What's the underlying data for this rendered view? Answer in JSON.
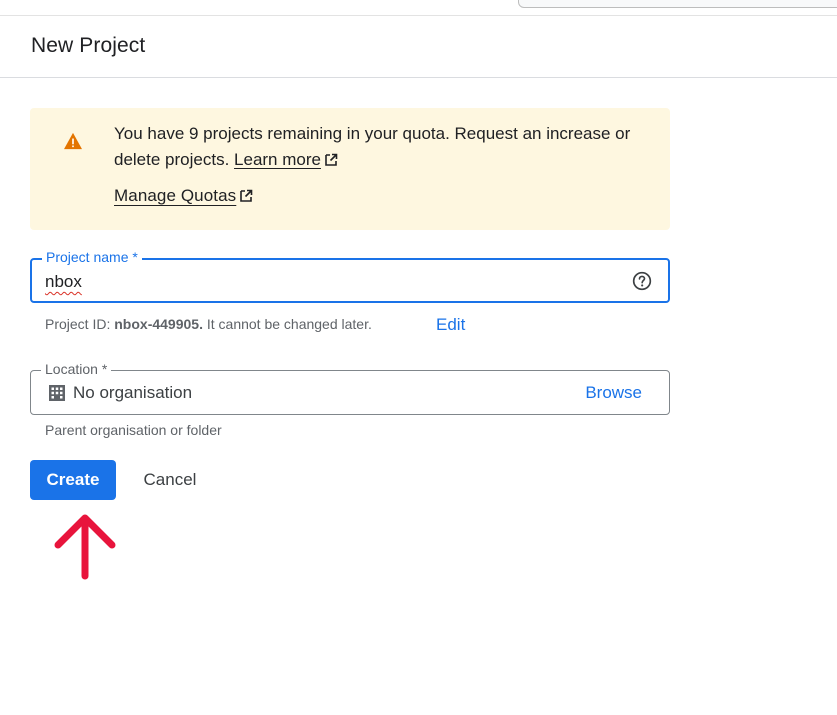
{
  "header": {
    "title": "New Project"
  },
  "quota_banner": {
    "icon": "warning-icon",
    "message": "You have 9 projects remaining in your quota. Request an increase or delete projects.",
    "learn_more_label": "Learn more",
    "manage_quotas_label": "Manage Quotas"
  },
  "project_name": {
    "label": "Project name *",
    "value": "nbox",
    "help_icon": "help-circle-icon"
  },
  "project_id": {
    "prefix": "Project ID:",
    "id": "nbox-449905.",
    "suffix": "It cannot be changed later.",
    "edit_label": "Edit"
  },
  "location": {
    "label": "Location *",
    "value": "No organisation",
    "icon": "building-icon",
    "browse_label": "Browse",
    "hint": "Parent organisation or folder"
  },
  "actions": {
    "create_label": "Create",
    "cancel_label": "Cancel"
  },
  "colors": {
    "primary": "#1a73e8",
    "banner_bg": "#fef7e0",
    "warning": "#e37400",
    "annotation_arrow": "#e8143c"
  }
}
